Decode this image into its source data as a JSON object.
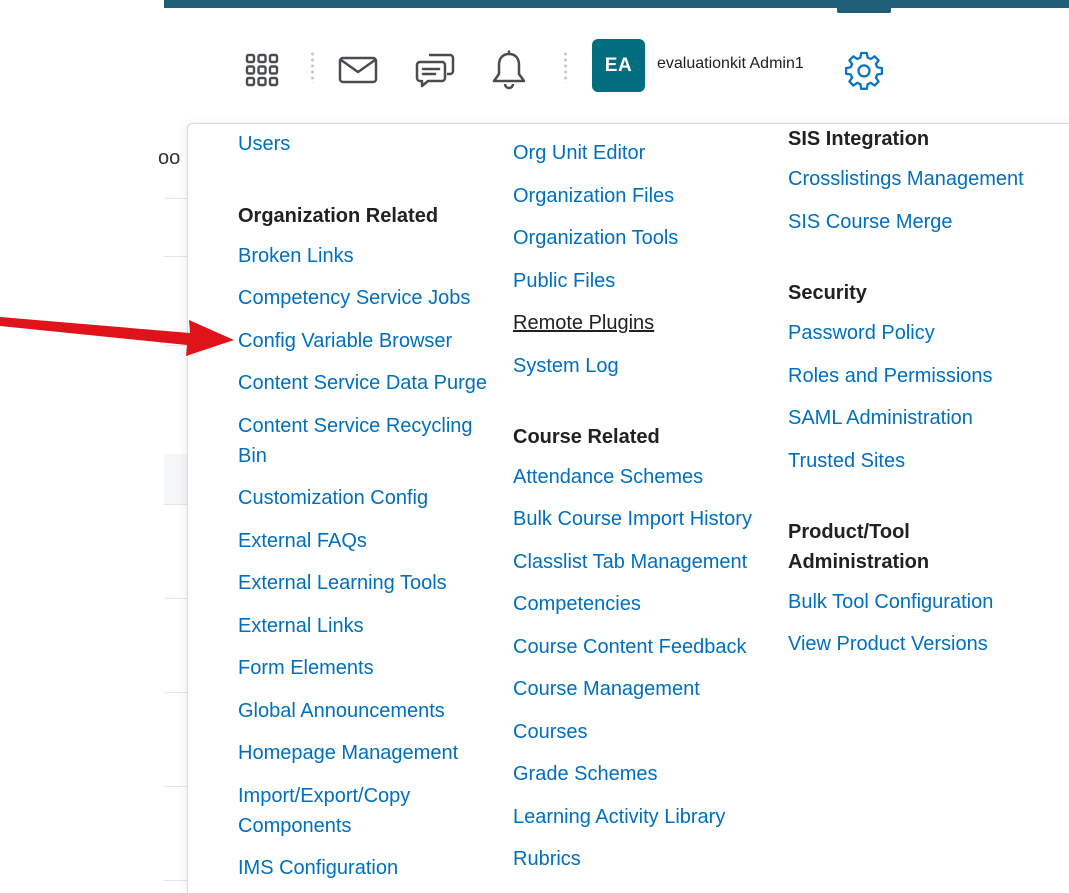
{
  "header": {
    "user_initials": "EA",
    "user_name": "evaluationkit Admin1",
    "icons": [
      "apps-grid-icon",
      "mail-icon",
      "chat-icon",
      "bell-icon",
      "gear-icon"
    ]
  },
  "background": {
    "partial_text": "oo"
  },
  "admin_menu": {
    "col1": {
      "top_item": "Users",
      "org_heading": "Organization Related",
      "org_items": [
        "Broken Links",
        "Competency Service Jobs",
        "Config Variable Browser",
        "Content Service Data Purge",
        "Content Service Recycling",
        "Bin",
        "Customization Config",
        "External FAQs",
        "External Learning Tools",
        "External Links",
        "Form Elements",
        "Global Announcements",
        "Homepage Management",
        "Import/Export/Copy",
        "Components",
        "IMS Configuration"
      ]
    },
    "col2": {
      "org_items": [
        "Org Unit Editor",
        "Organization Files",
        "Organization Tools",
        "Public Files",
        "Remote Plugins",
        "System Log"
      ],
      "course_heading": "Course Related",
      "course_items": [
        "Attendance Schemes",
        "Bulk Course Import History",
        "Classlist Tab Management",
        "Competencies",
        "Course Content Feedback",
        "Course Management",
        "Courses",
        "Grade Schemes",
        "Learning Activity Library",
        "Rubrics"
      ]
    },
    "col3": {
      "sis_heading": "SIS Integration",
      "sis_items": [
        "Crosslistings Management",
        "SIS Course Merge"
      ],
      "security_heading": "Security",
      "security_items": [
        "Password Policy",
        "Roles and Permissions",
        "SAML Administration",
        "Trusted Sites"
      ],
      "product_heading_line1": "Product/Tool",
      "product_heading_line2": "Administration",
      "product_items": [
        "Bulk Tool Configuration",
        "View Product Versions"
      ]
    }
  },
  "colors": {
    "link": "#006fbf",
    "avatar": "#006e7f",
    "top_bar": "#1f5f78",
    "arrow": "#e0131b"
  }
}
